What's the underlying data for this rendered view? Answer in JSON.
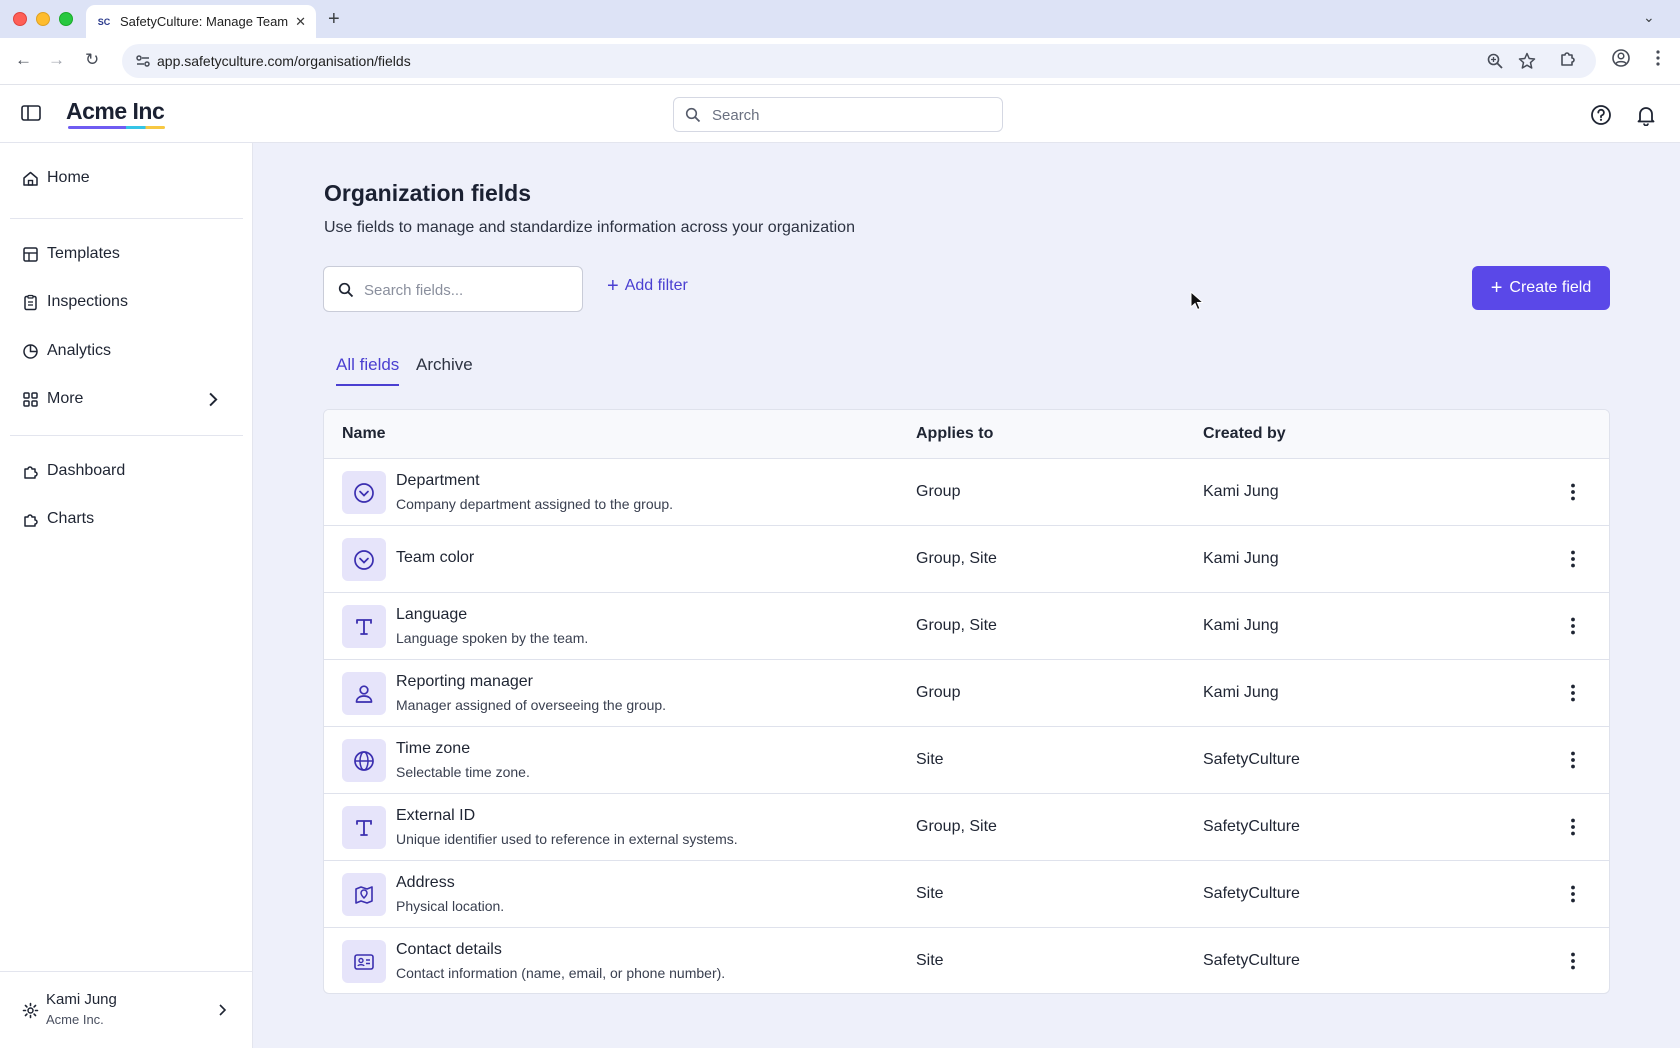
{
  "browser": {
    "tab_title": "SafetyCulture: Manage Teams",
    "tab_favicon": "SC",
    "url": "app.safetyculture.com/organisation/fields"
  },
  "header": {
    "brand": "Acme Inc",
    "search_placeholder": "Search",
    "accent_color": "#5a48e8"
  },
  "sidebar": {
    "items": [
      {
        "label": "Home",
        "icon": "home-icon"
      },
      {
        "label": "Templates",
        "icon": "templates-icon"
      },
      {
        "label": "Inspections",
        "icon": "clipboard-icon"
      },
      {
        "label": "Analytics",
        "icon": "pie-chart-icon"
      },
      {
        "label": "More",
        "icon": "grid-icon"
      },
      {
        "label": "Dashboard",
        "icon": "puzzle-icon"
      },
      {
        "label": "Charts",
        "icon": "puzzle-icon"
      }
    ],
    "user": {
      "name": "Kami Jung",
      "org": "Acme Inc."
    }
  },
  "main": {
    "title": "Organization fields",
    "subtitle": "Use fields to manage and standardize information across your organization",
    "search_placeholder": "Search fields...",
    "add_filter_label": "Add filter",
    "create_label": "Create field",
    "tabs": [
      {
        "label": "All fields",
        "active": true
      },
      {
        "label": "Archive",
        "active": false
      }
    ],
    "table": {
      "columns": [
        "Name",
        "Applies to",
        "Created by"
      ],
      "rows": [
        {
          "name": "Department",
          "description": "Company department assigned to the group.",
          "applies_to": "Group",
          "created_by": "Kami Jung",
          "icon": "dropdown-icon"
        },
        {
          "name": "Team color",
          "description": "",
          "applies_to": "Group, Site",
          "created_by": "Kami Jung",
          "icon": "dropdown-icon"
        },
        {
          "name": "Language",
          "description": "Language spoken by the team.",
          "applies_to": "Group, Site",
          "created_by": "Kami Jung",
          "icon": "text-icon"
        },
        {
          "name": "Reporting manager",
          "description": "Manager assigned of overseeing the group.",
          "applies_to": "Group",
          "created_by": "Kami Jung",
          "icon": "person-icon"
        },
        {
          "name": "Time zone",
          "description": "Selectable time zone.",
          "applies_to": "Site",
          "created_by": "SafetyCulture",
          "icon": "globe-icon"
        },
        {
          "name": "External ID",
          "description": "Unique identifier used to reference in external systems.",
          "applies_to": "Group, Site",
          "created_by": "SafetyCulture",
          "icon": "text-icon"
        },
        {
          "name": "Address",
          "description": "Physical location.",
          "applies_to": "Site",
          "created_by": "SafetyCulture",
          "icon": "map-pin-icon"
        },
        {
          "name": "Contact details",
          "description": "Contact information (name, email, or phone number).",
          "applies_to": "Site",
          "created_by": "SafetyCulture",
          "icon": "contact-card-icon"
        }
      ]
    }
  }
}
